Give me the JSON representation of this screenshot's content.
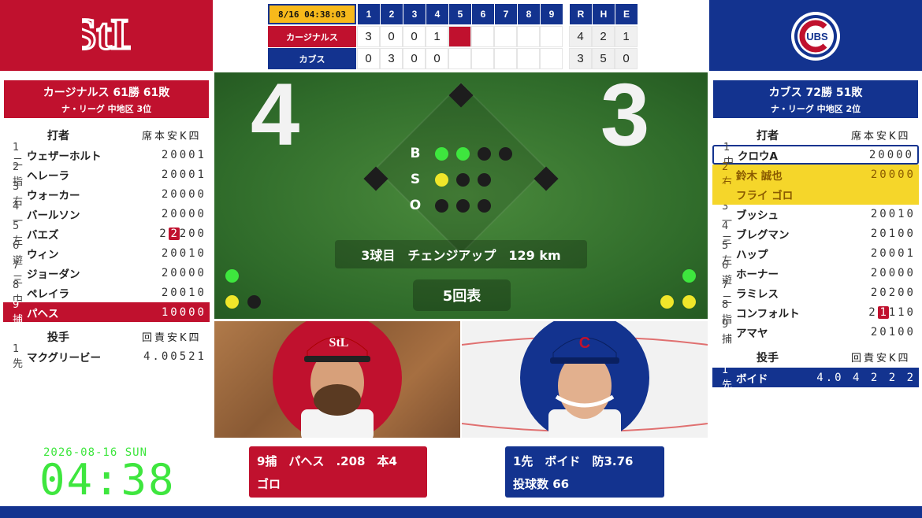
{
  "linescore": {
    "date": "8/16 04:38:03",
    "innings": [
      "1",
      "2",
      "3",
      "4",
      "5",
      "6",
      "7",
      "8",
      "9"
    ],
    "totals_hd": [
      "R",
      "H",
      "E"
    ],
    "teams": [
      {
        "name": "カージナルス",
        "color": "#c0112e",
        "runs": [
          "3",
          "0",
          "0",
          "1",
          "",
          "",
          "",
          "",
          ""
        ],
        "totals": [
          "4",
          "2",
          "1"
        ]
      },
      {
        "name": "カブス",
        "color": "#13338f",
        "runs": [
          "0",
          "3",
          "0",
          "0",
          "",
          "",
          "",
          "",
          ""
        ],
        "totals": [
          "3",
          "5",
          "0"
        ]
      }
    ]
  },
  "away": {
    "title": "カージナルス 61勝 61敗",
    "sub": "ナ・リーグ 中地区 3位",
    "batter_hd": "打者",
    "stat_hd": "席本安K四",
    "batters": [
      {
        "ord": "1二",
        "name": "ウェザーホルト",
        "stats": "20001"
      },
      {
        "ord": "2指",
        "name": "ヘレーラ",
        "stats": "20001"
      },
      {
        "ord": "3右",
        "name": "ウォーカー",
        "stats": "20000"
      },
      {
        "ord": "4一",
        "name": "バールソン",
        "stats": "20000"
      },
      {
        "ord": "5左",
        "name": "バエズ",
        "stats": "22200"
      },
      {
        "ord": "6遊",
        "name": "ウィン",
        "stats": "20010"
      },
      {
        "ord": "7三",
        "name": "ジョーダン",
        "stats": "20000"
      },
      {
        "ord": "8中",
        "name": "ペレイラ",
        "stats": "20010"
      },
      {
        "ord": "9捕",
        "name": "パヘス",
        "stats": "10000"
      }
    ],
    "pitcher_hd": "投手",
    "pitcher_stat_hd": "回責安K四",
    "pitchers": [
      {
        "ord": "1先",
        "name": "マクグリービー",
        "stats": "4.00521"
      }
    ]
  },
  "home": {
    "title": "カブス 72勝 51敗",
    "sub": "ナ・リーグ 中地区 2位",
    "batter_hd": "打者",
    "stat_hd": "席本安K四",
    "batters": [
      {
        "ord": "1中",
        "name": "クロウA",
        "stats": "20000"
      },
      {
        "ord": "2右",
        "name": "鈴木 誠也",
        "stats": "20000"
      },
      {
        "ord": "3一",
        "name": "ブッシュ",
        "stats": "20010"
      },
      {
        "ord": "4三",
        "name": "ブレグマン",
        "stats": "20100"
      },
      {
        "ord": "5左",
        "name": "ハップ",
        "stats": "20001"
      },
      {
        "ord": "6遊",
        "name": "ホーナー",
        "stats": "20000"
      },
      {
        "ord": "7二",
        "name": "ラミレス",
        "stats": "20200"
      },
      {
        "ord": "8指",
        "name": "コンフォルト",
        "stats": "21110"
      },
      {
        "ord": "9捕",
        "name": "アマヤ",
        "stats": "20100"
      }
    ],
    "current_result": "フライ ゴロ",
    "pitcher_hd": "投手",
    "pitcher_stat_hd": "回責安K四",
    "pitchers": [
      {
        "ord": "1先",
        "name": "ボイド",
        "stats": "4.0 4 2 2 2"
      }
    ]
  },
  "field": {
    "away_score": "4",
    "home_score": "3",
    "bso_labels": [
      "B",
      "S",
      "O"
    ],
    "balls": 2,
    "strikes": 1,
    "outs": 0,
    "pitch_info": "3球目　チェンジアップ　129 km",
    "inning": "5回表"
  },
  "captions": {
    "batter_line1": "9捕　パヘス　.208　本4",
    "batter_line2": "ゴロ",
    "pitcher_line1": "1先　ボイド　防3.76",
    "pitcher_line2": "投球数 66"
  },
  "clock": {
    "date": "2026-08-16 SUN",
    "time": "04:38"
  },
  "colors": {
    "cardinals": "#c0112e",
    "cubs": "#13338f",
    "highlight": "#f5d62a",
    "ball": "#3ee63e",
    "strike": "#f0e62a"
  }
}
